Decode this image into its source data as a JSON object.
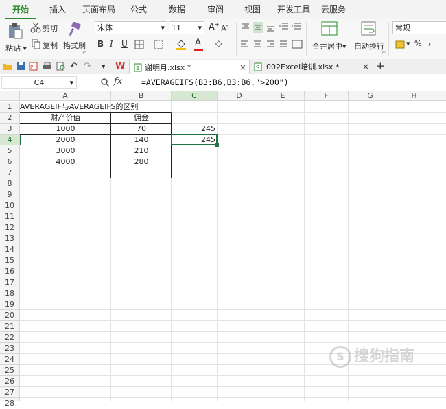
{
  "menu": {
    "tabs": [
      "开始",
      "插入",
      "页面布局",
      "公式",
      "数据",
      "审阅",
      "视图",
      "开发工具",
      "云服务"
    ]
  },
  "ribbon": {
    "paste": "粘贴",
    "cut": "剪切",
    "copy": "复制",
    "format_painter": "格式刷",
    "font_name": "宋体",
    "font_size": "11",
    "merge_center": "合并居中",
    "wrap_text": "自动换行",
    "number_format": "常规",
    "percent": "%",
    "comma": "‚"
  },
  "doc_tabs": [
    {
      "name": "谢明月.xlsx *",
      "close": "×"
    },
    {
      "name": "002Excel培训.xlsx *",
      "close": "×"
    }
  ],
  "add_tab": "+",
  "formula_bar": {
    "name_box": "C4",
    "fx": "fx",
    "formula": "=AVERAGEIFS(B3:B6,B3:B6,\">200\")"
  },
  "grid": {
    "columns": [
      "A",
      "B",
      "C",
      "D",
      "E",
      "F",
      "G",
      "H"
    ],
    "rows": [
      "1",
      "2",
      "3",
      "4",
      "5",
      "6",
      "7",
      "8",
      "9",
      "10",
      "11",
      "12",
      "13",
      "14",
      "15",
      "16",
      "17",
      "18",
      "19",
      "20",
      "21",
      "22",
      "23",
      "24",
      "25",
      "26",
      "27",
      "28"
    ],
    "a1_title": "AVERAGEIF与AVERAGEIFS的区别",
    "header_a": "财产价值",
    "header_b": "佣金",
    "data": [
      {
        "a": "1000",
        "b": "70"
      },
      {
        "a": "2000",
        "b": "140"
      },
      {
        "a": "3000",
        "b": "210"
      },
      {
        "a": "4000",
        "b": "280"
      }
    ],
    "c3": "245",
    "c4": "245"
  },
  "colors": {
    "accent": "#2b8a2b",
    "selection": "#217346"
  },
  "watermark": "搜狗指南"
}
